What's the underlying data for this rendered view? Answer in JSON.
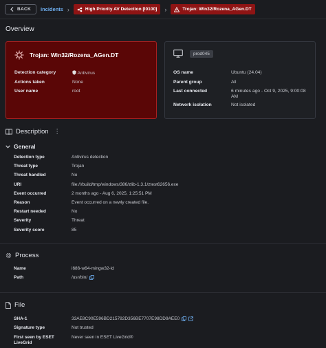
{
  "breadcrumb": {
    "back_label": "BACK",
    "incidents": "Incidents",
    "detection_label": "High Priority AV Detection [I0100]",
    "threat_label": "Trojan: Win32/Rozena_AGen.DT"
  },
  "page_title": "Overview",
  "threat_card": {
    "title": "Trojan: Win32/Rozena_AGen.DT",
    "fields": [
      {
        "label": "Detection category",
        "value": "Antivirus"
      },
      {
        "label": "Actions taken",
        "value": "None"
      },
      {
        "label": "User name",
        "value": "root"
      }
    ]
  },
  "device_card": {
    "hostname": "prod045",
    "fields": [
      {
        "label": "OS name",
        "value": "Ubuntu (24.04)"
      },
      {
        "label": "Parent group",
        "value": "All"
      },
      {
        "label": "Last connected",
        "value": "6 minutes ago - Oct 9, 2025, 9:00:08",
        "value2": "AM"
      },
      {
        "label": "Network isolation",
        "value": "Not isolated"
      }
    ]
  },
  "description": {
    "title": "Description",
    "menu_glyph": "⋮"
  },
  "general": {
    "title": "General",
    "rows": [
      {
        "label": "Detection type",
        "value": "Antivirus detection"
      },
      {
        "label": "Threat type",
        "value": "Trojan"
      },
      {
        "label": "Threat handled",
        "value": "No"
      },
      {
        "label": "URI",
        "value": "file:///build/tmp/windows/386/zlib-1.3.1/ztest62656.exe"
      },
      {
        "label": "Event occurred",
        "value": "2 months ago - Aug 6, 2025, 1:25:51 PM"
      },
      {
        "label": "Reason",
        "value": "Event occurred on a newly created file."
      },
      {
        "label": "Restart needed",
        "value": "No"
      },
      {
        "label": "Severity",
        "value": "Threat"
      },
      {
        "label": "Severity score",
        "value": "85"
      }
    ]
  },
  "process": {
    "title": "Process",
    "rows": [
      {
        "label": "Name",
        "value": "i686-w64-mingw32-ld"
      },
      {
        "label": "Path",
        "value": "/usr/bin/"
      }
    ]
  },
  "file": {
    "title": "File",
    "rows": [
      {
        "label": "SHA-1",
        "value": "33AE8C90E596BD215782D356BE7707E98DD9AEE0"
      },
      {
        "label": "Signature type",
        "value": "Not trusted"
      },
      {
        "label": "First seen by ESET",
        "label2": "LiveGrid",
        "value": "Never seen in ESET LiveGrid®"
      }
    ]
  },
  "colors": {
    "background": "#1b1c20",
    "threat_card": "#5a0606",
    "threat_border": "#a82020",
    "pill": "#8f1414",
    "link": "#6fb0f2"
  }
}
